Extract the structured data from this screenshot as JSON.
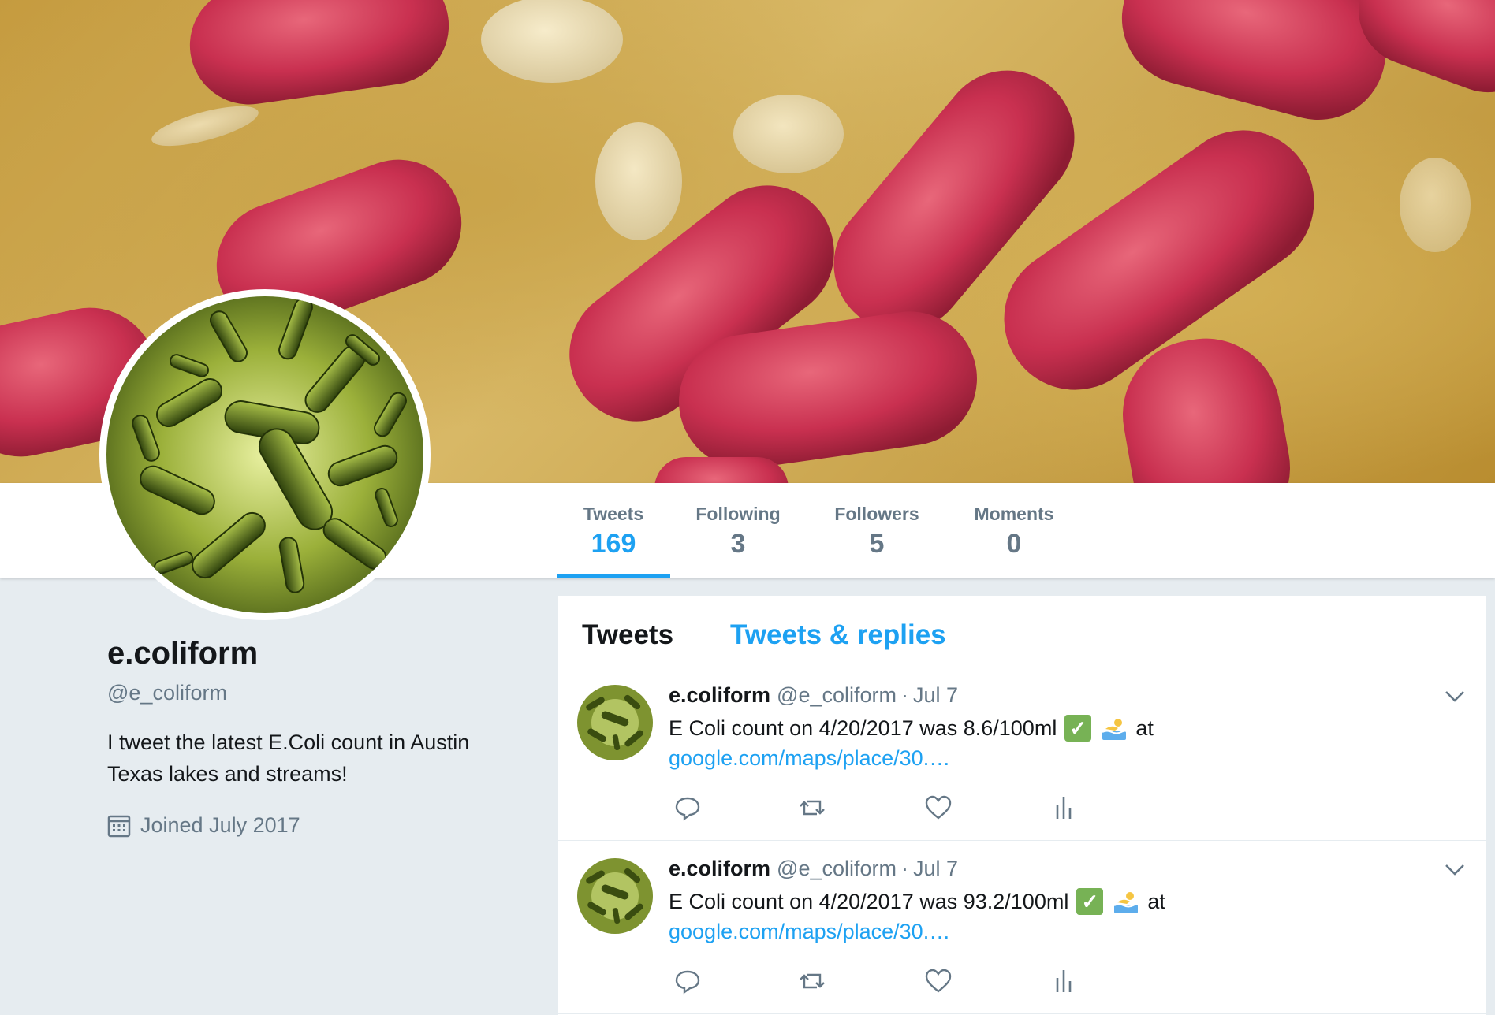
{
  "profile": {
    "name": "e.coliform",
    "handle": "@e_coliform",
    "bio": "I tweet the latest E.Coli count in Austin Texas lakes and streams!",
    "joined": "Joined July 2017"
  },
  "stats": [
    {
      "label": "Tweets",
      "value": "169",
      "active": true
    },
    {
      "label": "Following",
      "value": "3",
      "active": false
    },
    {
      "label": "Followers",
      "value": "5",
      "active": false
    },
    {
      "label": "Moments",
      "value": "0",
      "active": false
    }
  ],
  "tabs": {
    "tweets": "Tweets",
    "replies": "Tweets & replies"
  },
  "tweets": [
    {
      "name": "e.coliform",
      "handle": "@e_coliform",
      "separator": "·",
      "date": "Jul 7",
      "text": "E Coli count on 4/20/2017 was 8.6/100ml",
      "after": "at",
      "link": "google.com/maps/place/30.…"
    },
    {
      "name": "e.coliform",
      "handle": "@e_coliform",
      "separator": "·",
      "date": "Jul 7",
      "text": "E Coli count on 4/20/2017 was 93.2/100ml",
      "after": "at",
      "link": "google.com/maps/place/30.…"
    }
  ],
  "icons": {
    "check": "white-heavy-check-mark-icon",
    "swim": "swimmer-icon",
    "reply": "reply-icon",
    "retweet": "retweet-icon",
    "like": "heart-icon",
    "analytics": "analytics-icon",
    "chevron": "chevron-down-icon",
    "calendar": "calendar-icon"
  },
  "colors": {
    "accent": "#1da1f2",
    "muted": "#657786",
    "text": "#14171a",
    "background": "#e6ecf0"
  }
}
